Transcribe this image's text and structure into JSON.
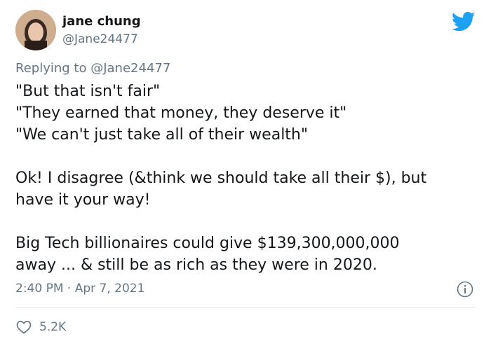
{
  "author": {
    "name": "jane chung",
    "handle": "@Jane24477"
  },
  "reply": {
    "prefix": "Replying to",
    "mention": "@Jane24477"
  },
  "tweet": {
    "paragraphs": [
      [
        "\"But that isn't fair\"",
        "\"They earned that money, they deserve it\"",
        "\"We can't just take all of their wealth\""
      ],
      [
        "Ok! I disagree (&think we should take all their $), but",
        "have it your way!"
      ],
      [
        "Big Tech billionaires could give $139,300,000,000",
        "away ... & still be as rich as they were in 2020."
      ]
    ]
  },
  "meta": {
    "timestamp": "2:40 PM · Apr 7, 2021",
    "like_count": "5.2K"
  },
  "icons": {
    "logo": "twitter-bird-icon",
    "info": "info-icon",
    "like": "heart-icon"
  },
  "colors": {
    "twitter_blue": "#1da1f2",
    "secondary_text": "#657786",
    "primary_text": "#14171a",
    "divider": "#e1e8ed"
  }
}
